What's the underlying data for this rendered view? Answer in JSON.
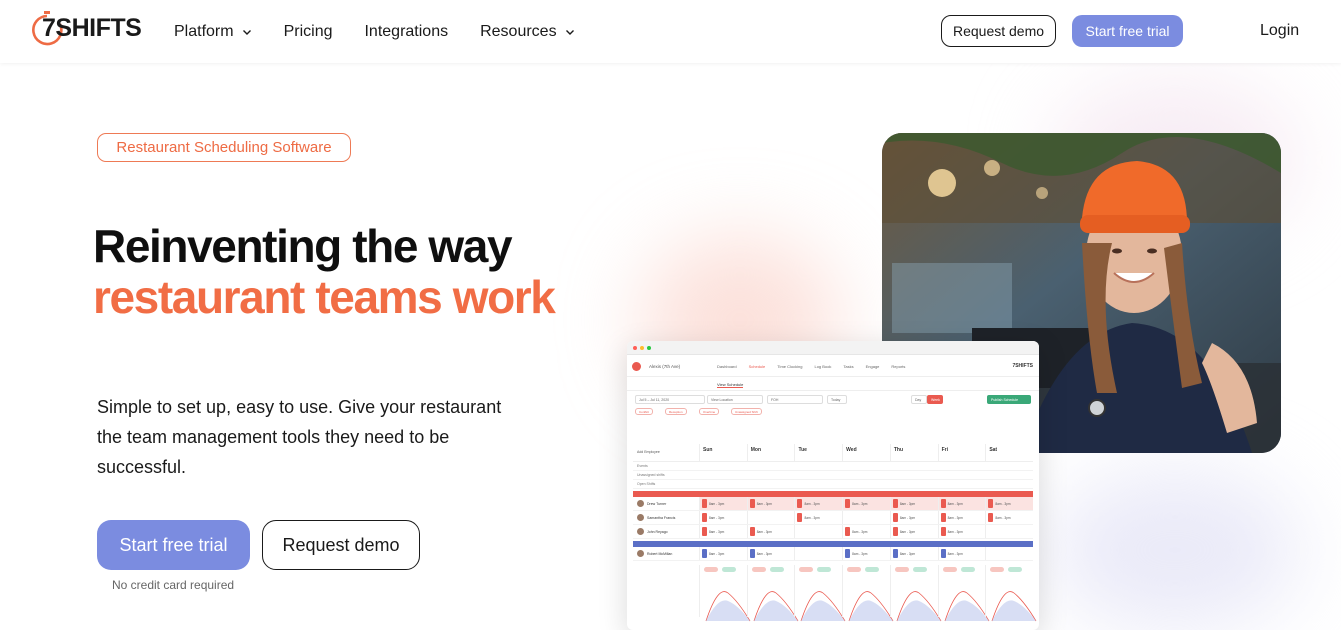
{
  "header": {
    "logo_text": "7SHIFTS",
    "nav": [
      {
        "label": "Platform",
        "has_dropdown": true
      },
      {
        "label": "Pricing",
        "has_dropdown": false
      },
      {
        "label": "Integrations",
        "has_dropdown": false
      },
      {
        "label": "Resources",
        "has_dropdown": true
      }
    ],
    "request_demo": "Request demo",
    "start_trial": "Start free trial",
    "login": "Login"
  },
  "hero": {
    "badge": "Restaurant Scheduling Software",
    "headline_line1": "Reinventing the way",
    "headline_line2": "restaurant teams work",
    "subtitle": "Simple to set up, easy to use. Give your restaurant the team management tools they need to be successful.",
    "cta_primary": "Start free trial",
    "cta_secondary": "Request demo",
    "note": "No credit card required"
  },
  "app_preview": {
    "location": "Alexis (7th Ave)",
    "tabs": [
      "Dashboard",
      "Schedule",
      "Time Clocking",
      "Log Book",
      "Tasks",
      "Engage",
      "Reports"
    ],
    "active_tab": "Schedule",
    "brand": "7SHIFTS",
    "sub_tab": "View Schedule",
    "tools": {
      "date_range": "Jul 5 – Jul 11, 2020",
      "view": "View Location",
      "dept": "FOH",
      "today": "Today",
      "day": "Day",
      "week": "Week",
      "publish": "Publish Schedule"
    },
    "filters": [
      "Conflict",
      "Reception",
      "Overtime",
      "Unassigned Shift"
    ],
    "add_employee": "Add Employee",
    "days": [
      "Sun",
      "Mon",
      "Tue",
      "Wed",
      "Thu",
      "Fri",
      "Sat"
    ],
    "row_labels": [
      "Events",
      "Unassigned shifts",
      "Open Shifts"
    ],
    "employees": [
      "Drew Turner",
      "Samantha Francis",
      "John Reyago",
      "Robert McMillan"
    ],
    "shift_label": "8am - 3pm"
  },
  "colors": {
    "accent_orange": "#f16d45",
    "accent_purple": "#7b8ce0",
    "app_red": "#ea5a50",
    "app_blue": "#5b6fc6"
  }
}
